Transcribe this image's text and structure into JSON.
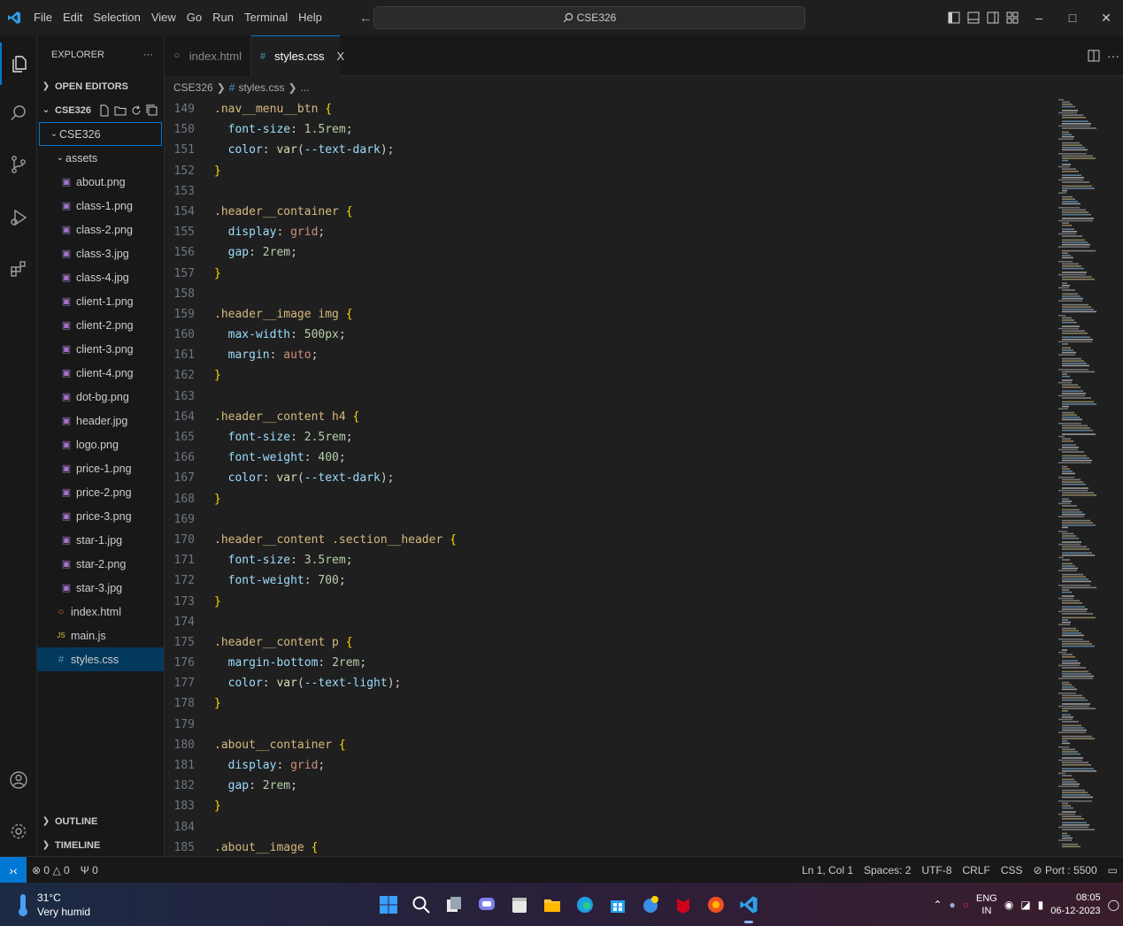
{
  "menu": [
    "File",
    "Edit",
    "Selection",
    "View",
    "Go",
    "Run",
    "Terminal",
    "Help"
  ],
  "search": {
    "label": "CSE326"
  },
  "sidebar": {
    "title": "EXPLORER",
    "more": "···",
    "open_editors": "OPEN EDITORS",
    "workspace": "CSE326",
    "root_folder": "CSE326",
    "assets_folder": "assets",
    "asset_files": [
      "about.png",
      "class-1.png",
      "class-2.png",
      "class-3.jpg",
      "class-4.jpg",
      "client-1.png",
      "client-2.png",
      "client-3.png",
      "client-4.png",
      "dot-bg.png",
      "header.jpg",
      "logo.png",
      "price-1.png",
      "price-2.png",
      "price-3.png",
      "star-1.jpg",
      "star-2.png",
      "star-3.jpg"
    ],
    "root_files": [
      "index.html",
      "main.js",
      "styles.css"
    ],
    "outline": "OUTLINE",
    "timeline": "TIMELINE"
  },
  "tabs": [
    {
      "label": "index.html",
      "icon": "html-file-icon"
    },
    {
      "label": "styles.css",
      "icon": "css-file-icon",
      "close": "X"
    }
  ],
  "breadcrumb": {
    "folder": "CSE326",
    "file": "styles.css",
    "tail": "..."
  },
  "code_lines": [
    {
      "n": "149",
      "tokens": [
        [
          "sel",
          ".nav__menu__btn "
        ],
        [
          "brace",
          "{"
        ]
      ]
    },
    {
      "n": "150",
      "tokens": [
        [
          "prop",
          "  font-size"
        ],
        [
          "punc",
          ": "
        ],
        [
          "num",
          "1.5rem"
        ],
        [
          "punc",
          ";"
        ]
      ]
    },
    {
      "n": "151",
      "tokens": [
        [
          "prop",
          "  color"
        ],
        [
          "punc",
          ": "
        ],
        [
          "fn",
          "var"
        ],
        [
          "punc",
          "("
        ],
        [
          "var",
          "--text-dark"
        ],
        [
          "punc",
          ");"
        ]
      ]
    },
    {
      "n": "152",
      "tokens": [
        [
          "brace",
          "}"
        ]
      ]
    },
    {
      "n": "153",
      "tokens": []
    },
    {
      "n": "154",
      "tokens": [
        [
          "sel",
          ".header__container "
        ],
        [
          "brace",
          "{"
        ]
      ]
    },
    {
      "n": "155",
      "tokens": [
        [
          "prop",
          "  display"
        ],
        [
          "punc",
          ": "
        ],
        [
          "val",
          "grid"
        ],
        [
          "punc",
          ";"
        ]
      ]
    },
    {
      "n": "156",
      "tokens": [
        [
          "prop",
          "  gap"
        ],
        [
          "punc",
          ": "
        ],
        [
          "num",
          "2rem"
        ],
        [
          "punc",
          ";"
        ]
      ]
    },
    {
      "n": "157",
      "tokens": [
        [
          "brace",
          "}"
        ]
      ]
    },
    {
      "n": "158",
      "tokens": []
    },
    {
      "n": "159",
      "tokens": [
        [
          "sel",
          ".header__image img "
        ],
        [
          "brace",
          "{"
        ]
      ]
    },
    {
      "n": "160",
      "tokens": [
        [
          "prop",
          "  max-width"
        ],
        [
          "punc",
          ": "
        ],
        [
          "num",
          "500px"
        ],
        [
          "punc",
          ";"
        ]
      ]
    },
    {
      "n": "161",
      "tokens": [
        [
          "prop",
          "  margin"
        ],
        [
          "punc",
          ": "
        ],
        [
          "val",
          "auto"
        ],
        [
          "punc",
          ";"
        ]
      ]
    },
    {
      "n": "162",
      "tokens": [
        [
          "brace",
          "}"
        ]
      ]
    },
    {
      "n": "163",
      "tokens": []
    },
    {
      "n": "164",
      "tokens": [
        [
          "sel",
          ".header__content h4 "
        ],
        [
          "brace",
          "{"
        ]
      ]
    },
    {
      "n": "165",
      "tokens": [
        [
          "prop",
          "  font-size"
        ],
        [
          "punc",
          ": "
        ],
        [
          "num",
          "2.5rem"
        ],
        [
          "punc",
          ";"
        ]
      ]
    },
    {
      "n": "166",
      "tokens": [
        [
          "prop",
          "  font-weight"
        ],
        [
          "punc",
          ": "
        ],
        [
          "num",
          "400"
        ],
        [
          "punc",
          ";"
        ]
      ]
    },
    {
      "n": "167",
      "tokens": [
        [
          "prop",
          "  color"
        ],
        [
          "punc",
          ": "
        ],
        [
          "fn",
          "var"
        ],
        [
          "punc",
          "("
        ],
        [
          "var",
          "--text-dark"
        ],
        [
          "punc",
          ");"
        ]
      ]
    },
    {
      "n": "168",
      "tokens": [
        [
          "brace",
          "}"
        ]
      ]
    },
    {
      "n": "169",
      "tokens": []
    },
    {
      "n": "170",
      "tokens": [
        [
          "sel",
          ".header__content .section__header "
        ],
        [
          "brace",
          "{"
        ]
      ]
    },
    {
      "n": "171",
      "tokens": [
        [
          "prop",
          "  font-size"
        ],
        [
          "punc",
          ": "
        ],
        [
          "num",
          "3.5rem"
        ],
        [
          "punc",
          ";"
        ]
      ]
    },
    {
      "n": "172",
      "tokens": [
        [
          "prop",
          "  font-weight"
        ],
        [
          "punc",
          ": "
        ],
        [
          "num",
          "700"
        ],
        [
          "punc",
          ";"
        ]
      ]
    },
    {
      "n": "173",
      "tokens": [
        [
          "brace",
          "}"
        ]
      ]
    },
    {
      "n": "174",
      "tokens": []
    },
    {
      "n": "175",
      "tokens": [
        [
          "sel",
          ".header__content p "
        ],
        [
          "brace",
          "{"
        ]
      ]
    },
    {
      "n": "176",
      "tokens": [
        [
          "prop",
          "  margin-bottom"
        ],
        [
          "punc",
          ": "
        ],
        [
          "num",
          "2rem"
        ],
        [
          "punc",
          ";"
        ]
      ]
    },
    {
      "n": "177",
      "tokens": [
        [
          "prop",
          "  color"
        ],
        [
          "punc",
          ": "
        ],
        [
          "fn",
          "var"
        ],
        [
          "punc",
          "("
        ],
        [
          "var",
          "--text-light"
        ],
        [
          "punc",
          ");"
        ]
      ]
    },
    {
      "n": "178",
      "tokens": [
        [
          "brace",
          "}"
        ]
      ]
    },
    {
      "n": "179",
      "tokens": []
    },
    {
      "n": "180",
      "tokens": [
        [
          "sel",
          ".about__container "
        ],
        [
          "brace",
          "{"
        ]
      ]
    },
    {
      "n": "181",
      "tokens": [
        [
          "prop",
          "  display"
        ],
        [
          "punc",
          ": "
        ],
        [
          "val",
          "grid"
        ],
        [
          "punc",
          ";"
        ]
      ]
    },
    {
      "n": "182",
      "tokens": [
        [
          "prop",
          "  gap"
        ],
        [
          "punc",
          ": "
        ],
        [
          "num",
          "2rem"
        ],
        [
          "punc",
          ";"
        ]
      ]
    },
    {
      "n": "183",
      "tokens": [
        [
          "brace",
          "}"
        ]
      ]
    },
    {
      "n": "184",
      "tokens": []
    },
    {
      "n": "185",
      "tokens": [
        [
          "sel",
          ".about__image "
        ],
        [
          "brace",
          "{"
        ]
      ]
    }
  ],
  "status": {
    "errors": "0",
    "warnings": "0",
    "ports": "0",
    "position": "Ln 1, Col 1",
    "spaces": "Spaces: 2",
    "encoding": "UTF-8",
    "eol": "CRLF",
    "language": "CSS",
    "port": "Port : 5500"
  },
  "taskbar": {
    "temp": "31°C",
    "weather": "Very humid",
    "lang_top": "ENG",
    "lang_bottom": "IN",
    "time": "08:05",
    "date": "06-12-2023"
  },
  "colors": {
    "accent": "#0078d4",
    "editor_bg": "#1f1f1f",
    "sidebar_bg": "#181818",
    "selected_row": "#04395e"
  }
}
